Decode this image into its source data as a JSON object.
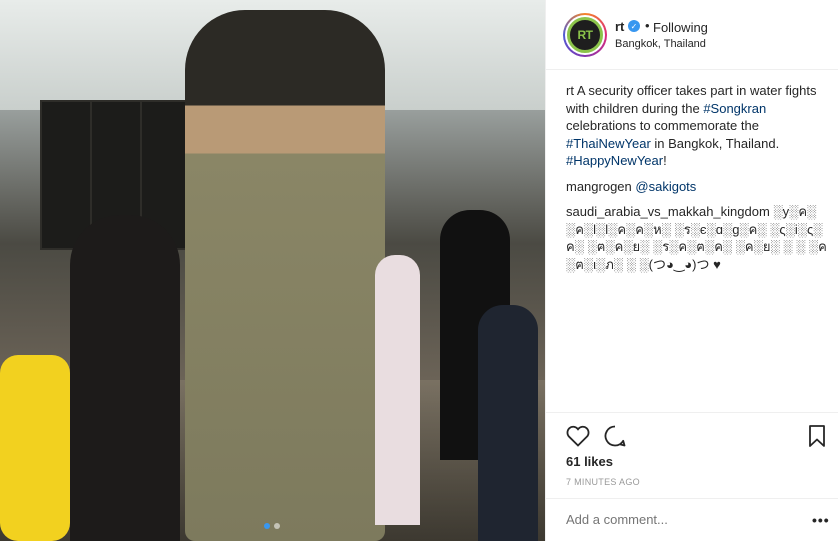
{
  "post": {
    "username": "rt",
    "verified_icon": "verified-badge-icon",
    "separator": "•",
    "follow_status": "Following",
    "location": "Bangkok, Thailand",
    "avatar_text": "RT"
  },
  "caption": {
    "username": "rt",
    "text_1": " A security officer takes part in water fights with children during the ",
    "tag_1": "#Songkran",
    "text_2": " celebrations to commemorate the ",
    "tag_2": "#ThaiNewYear",
    "text_3": " in Bangkok, Thailand. ",
    "tag_3": "#HappyNewYear",
    "text_4": "!"
  },
  "comments": [
    {
      "username": "mangrogen",
      "mention": "@sakigots"
    },
    {
      "username": "saudi_arabia_vs_makkah_kingdom",
      "text": " ░y░ค░ ░ค░l░l░ค░ค░ห░ ░ร░є░ɑ░g░ค░ ░ς░i░ς░ค░ ░ฅ░ค░ย░ ░ร░ค░ฅ░ค░ ░ค░ย░ ░ ░ ░ค░ฅ░ι░ภ░ ░ ░(つ◕‿◕)つ ♥"
    }
  ],
  "actions": {
    "likes": "61 likes",
    "timestamp": "7 MINUTES AGO",
    "add_comment_placeholder": "Add a comment...",
    "more_label": "•••"
  },
  "colors": {
    "link": "#003569",
    "accent": "#3897f0",
    "avatar_border": "#8bc34a"
  }
}
